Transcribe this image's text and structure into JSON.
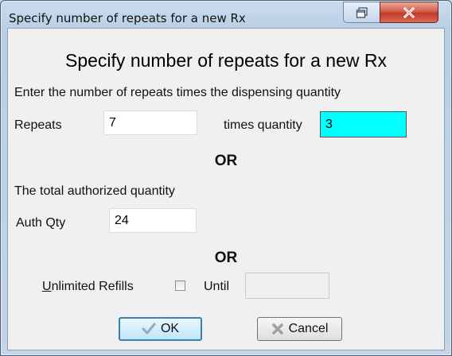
{
  "window": {
    "title": "Specify number of repeats for a new Rx",
    "restore_icon": "restore-window-icon",
    "close_icon": "close-x-icon"
  },
  "dialog": {
    "heading": "Specify number of repeats for a new Rx",
    "instruction": "Enter the number of repeats times the dispensing quantity",
    "repeats_label": "Repeats",
    "repeats_value": "7",
    "times_quantity_label": "times quantity",
    "times_quantity_value": "3",
    "or_label_1": "OR",
    "total_label": "The total authorized quantity",
    "auth_qty_label": "Auth Qty",
    "auth_qty_value": "24",
    "or_label_2": "OR",
    "unlimited_refills_label_first": "U",
    "unlimited_refills_label_rest": "nlimited Refills",
    "unlimited_checked": false,
    "until_label": "Until",
    "until_value": ""
  },
  "buttons": {
    "ok_label": "OK",
    "ok_icon": "checkmark-icon",
    "cancel_label": "Cancel",
    "cancel_icon": "cancel-x-icon"
  },
  "colors": {
    "highlight_field": "#00ffff",
    "close_button": "#c0392b"
  }
}
